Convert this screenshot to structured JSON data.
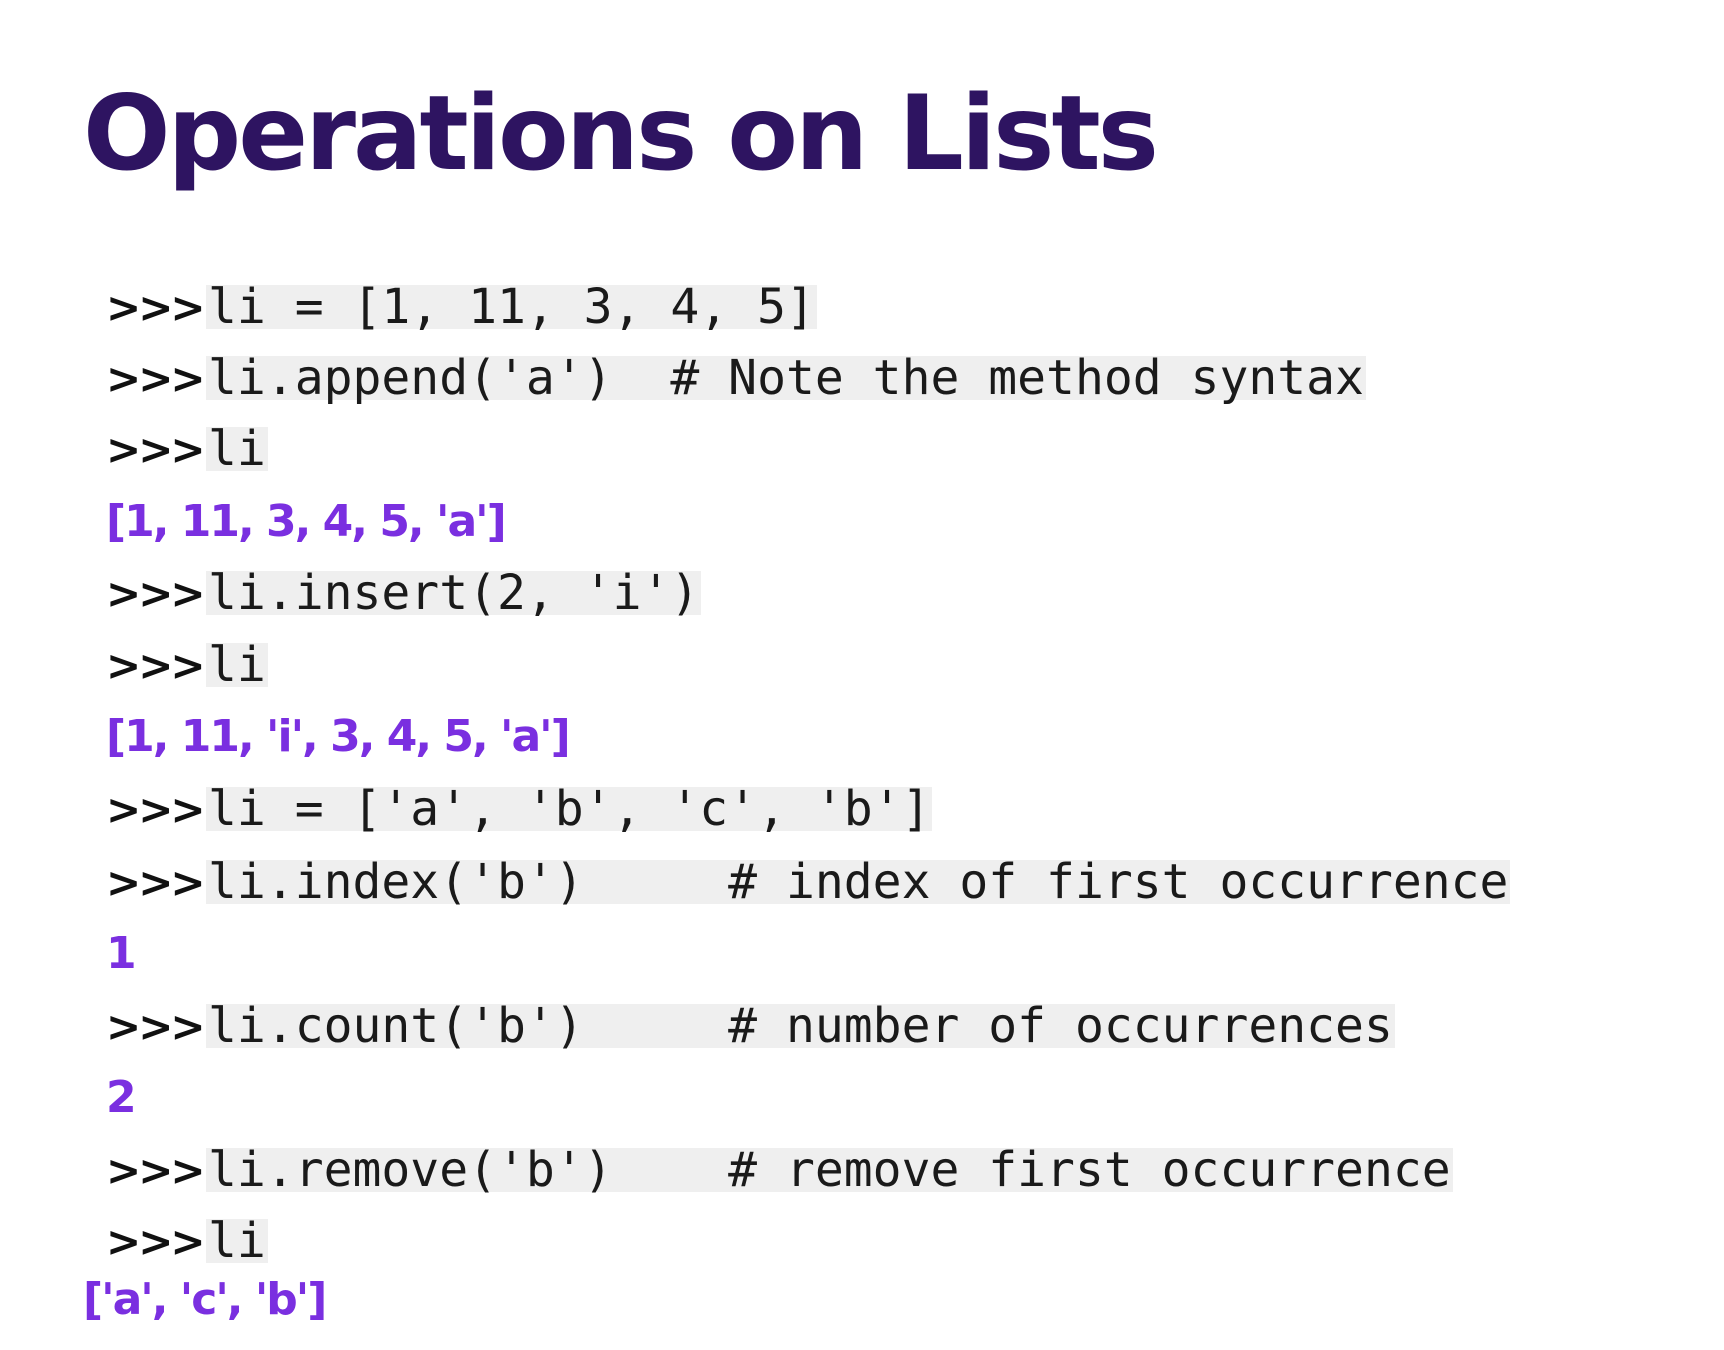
{
  "title": "Operations on Lists",
  "colors": {
    "title": "#2e1461",
    "prompt": "#111111",
    "code_background": "#efefef",
    "output": "#7a2fe0"
  },
  "lines": [
    {
      "kind": "input",
      "prompt": ">>>",
      "code": "li = [1, 11, 3, 4, 5]"
    },
    {
      "kind": "input",
      "prompt": ">>>",
      "code": "li.append('a')  # Note the method syntax"
    },
    {
      "kind": "input",
      "prompt": ">>>",
      "code": "li"
    },
    {
      "kind": "output",
      "text": "[1, 11, 3, 4, 5, 'a']"
    },
    {
      "kind": "input",
      "prompt": ">>>",
      "code": "li.insert(2, 'i')"
    },
    {
      "kind": "input",
      "prompt": ">>>",
      "code": "li"
    },
    {
      "kind": "output",
      "text": "[1, 11, 'i', 3, 4, 5, 'a']"
    },
    {
      "kind": "input",
      "prompt": ">>>",
      "code": "li = ['a', 'b', 'c', 'b']"
    },
    {
      "kind": "input",
      "prompt": ">>>",
      "code": "li.index('b')     # index of first occurrence"
    },
    {
      "kind": "output",
      "text": "1"
    },
    {
      "kind": "input",
      "prompt": ">>>",
      "code": "li.count('b')     # number of occurrences"
    },
    {
      "kind": "output",
      "text": "2"
    },
    {
      "kind": "input",
      "prompt": ">>>",
      "code": "li.remove('b')    # remove first occurrence"
    },
    {
      "kind": "input",
      "prompt": ">>>",
      "code": "li"
    },
    {
      "kind": "output",
      "text": "['a', 'c', 'b']"
    }
  ]
}
